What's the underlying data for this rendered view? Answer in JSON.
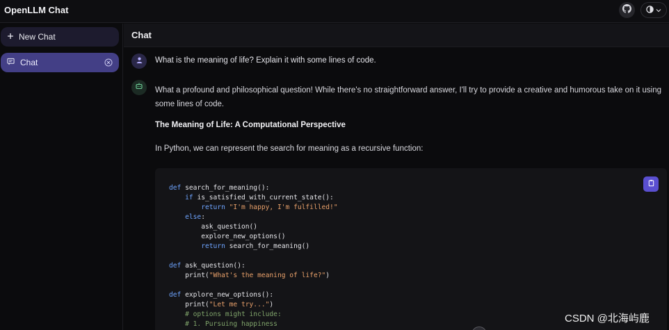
{
  "app": {
    "title": "OpenLLM Chat"
  },
  "topbar": {
    "github_icon": "github-icon",
    "theme_icon": "half-circle-icon"
  },
  "sidebar": {
    "new_chat_label": "New Chat",
    "chats": [
      {
        "label": "Chat"
      }
    ]
  },
  "main": {
    "title": "Chat",
    "user_message": "What is the meaning of life? Explain it with some lines of code.",
    "bot": {
      "intro": "What a profound and philosophical question! While there's no straightforward answer, I'll try to provide a creative and humorous take on it using some lines of code.",
      "heading": "The Meaning of Life: A Computational Perspective",
      "lead": "In Python, we can represent the search for meaning as a recursive function:"
    },
    "code_lines": [
      "def search_for_meaning():",
      "    if is_satisfied_with_current_state():",
      "        return \"I'm happy, I'm fulfilled!\"",
      "    else:",
      "        ask_question()",
      "        explore_new_options()",
      "        return search_for_meaning()",
      "",
      "def ask_question():",
      "    print(\"What's the meaning of life?\")",
      "",
      "def explore_new_options():",
      "    print(\"Let me try...\")",
      "    # options might include:",
      "    # 1. Pursuing happiness"
    ]
  },
  "watermark": "CSDN @北海屿鹿",
  "colors": {
    "accent": "#433f86",
    "copy_button": "#5a4fd0",
    "keyword": "#6ea4ff",
    "string": "#e8a06a",
    "comment": "#7fa36a"
  }
}
